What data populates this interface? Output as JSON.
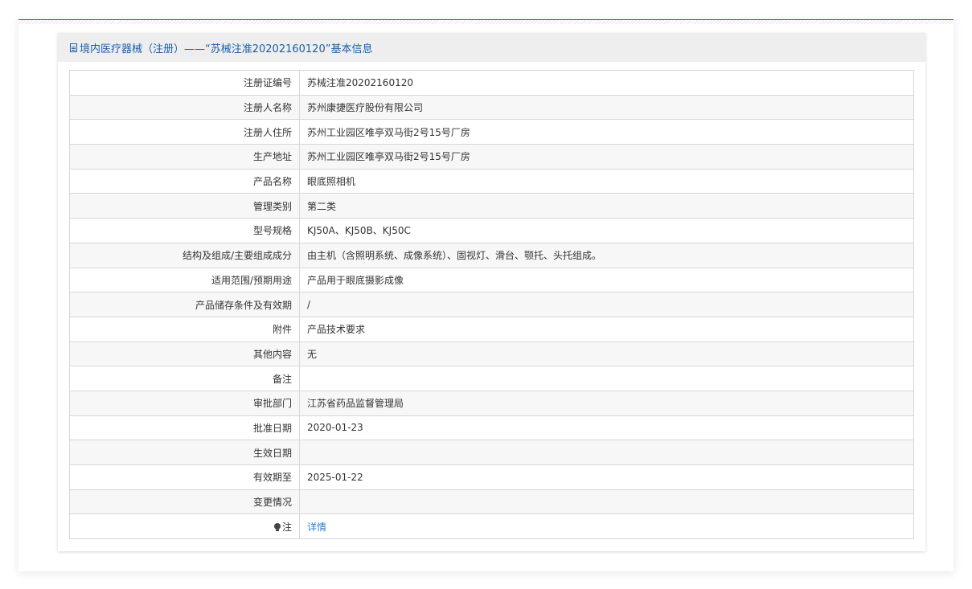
{
  "panel": {
    "title": "境内医疗器械（注册）——“苏械注准20202160120”基本信息"
  },
  "rows": [
    {
      "label": "注册证编号",
      "value": "苏械注准20202160120"
    },
    {
      "label": "注册人名称",
      "value": "苏州康捷医疗股份有限公司"
    },
    {
      "label": "注册人住所",
      "value": "苏州工业园区唯亭双马街2号15号厂房"
    },
    {
      "label": "生产地址",
      "value": "苏州工业园区唯亭双马街2号15号厂房"
    },
    {
      "label": "产品名称",
      "value": "眼底照相机"
    },
    {
      "label": "管理类别",
      "value": "第二类"
    },
    {
      "label": "型号规格",
      "value": "KJ50A、KJ50B、KJ50C"
    },
    {
      "label": "结构及组成/主要组成成分",
      "value": "由主机（含照明系统、成像系统）、固视灯、滑台、颚托、头托组成。"
    },
    {
      "label": "适用范围/预期用途",
      "value": "产品用于眼底摄影成像"
    },
    {
      "label": "产品储存条件及有效期",
      "value": "/"
    },
    {
      "label": "附件",
      "value": "产品技术要求"
    },
    {
      "label": "其他内容",
      "value": "无"
    },
    {
      "label": "备注",
      "value": ""
    },
    {
      "label": "审批部门",
      "value": "江苏省药品监督管理局"
    },
    {
      "label": "批准日期",
      "value": "2020-01-23"
    },
    {
      "label": "生效日期",
      "value": ""
    },
    {
      "label": "有效期至",
      "value": "2025-01-22"
    },
    {
      "label": "变更情况",
      "value": ""
    }
  ],
  "note": {
    "label": "注",
    "link_text": "详情",
    "icon": "bulb-icon"
  },
  "colors": {
    "accent": "#1b5fa6",
    "link": "#2f7fc8",
    "header_bg": "#eeeeee",
    "row_alt_bg": "#f7f7f7"
  }
}
